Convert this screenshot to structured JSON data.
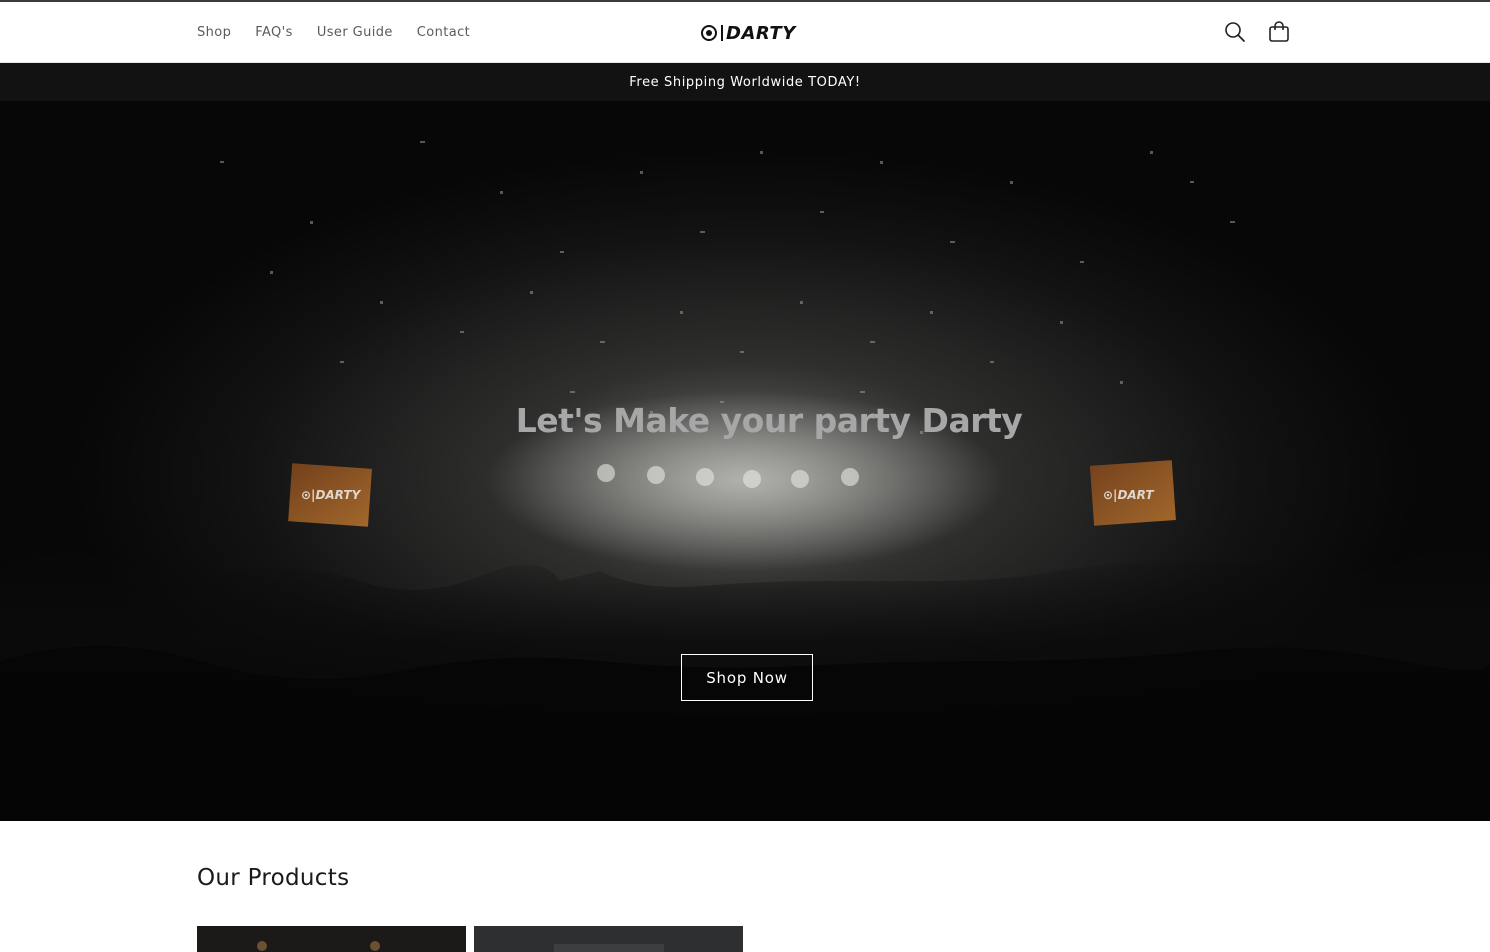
{
  "header": {
    "nav": [
      {
        "label": "Shop"
      },
      {
        "label": "FAQ's"
      },
      {
        "label": "User Guide"
      },
      {
        "label": "Contact"
      }
    ],
    "logo_text": "DARTY",
    "icons": [
      "search-icon",
      "cart-icon"
    ]
  },
  "announcement": {
    "text": "Free Shipping Worldwide TODAY!"
  },
  "hero": {
    "title": "Let's Make your party Darty",
    "button_label": "Shop Now",
    "screen_logo_left": "⊙|DARTY",
    "screen_logo_right": "⊙|DART"
  },
  "products": {
    "heading": "Our Products"
  },
  "colors": {
    "announcement_bg": "#121212",
    "text": "#121212",
    "nav_text": "#5b5b5b",
    "hero_title": "#a7a7a7"
  }
}
